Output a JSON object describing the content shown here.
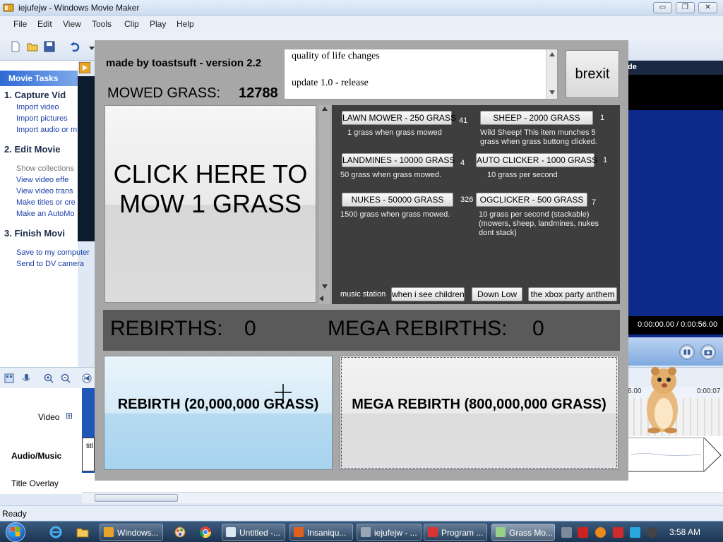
{
  "window": {
    "title": "iejufejw - Windows Movie Maker",
    "controls": {
      "minimize": "▭",
      "maximize": "❐",
      "close": "✕"
    }
  },
  "menu": [
    "File",
    "Edit",
    "View",
    "Tools",
    "Clip",
    "Play",
    "Help"
  ],
  "tasks": {
    "header": "Movie Tasks",
    "sections": [
      {
        "title": "1. Capture Vid",
        "links": [
          "Import video",
          "Import pictures",
          "Import audio or m"
        ]
      },
      {
        "title": "2. Edit Movie",
        "links": [
          "Show collections",
          "View video effe",
          "View video trans",
          "Make titles or cre",
          "Make an AutoMo"
        ]
      },
      {
        "title": "3. Finish Movi",
        "links": [
          "Save to my computer",
          "Send to DV camera"
        ]
      }
    ]
  },
  "monitor": {
    "header": "de",
    "time": "0:00:00.00 / 0:00:56.00"
  },
  "timeline": {
    "tracks": [
      "Video",
      "Audio/Music",
      "Title Overlay"
    ],
    "expand": "⊞",
    "ruler_marks": [
      "6.00",
      "0:00:07"
    ],
    "audio_clip_label": "titl"
  },
  "status": "Ready",
  "taskbar": {
    "buttons": [
      "Windows...",
      "Untitled -...",
      "Insaniqu...",
      "iejufejw - ...",
      "Program ...",
      "Grass Mo..."
    ],
    "active_index": 5,
    "clock": "3:58 AM"
  },
  "game": {
    "credit": "made by toastsuft - version 2.2",
    "notes": [
      "quality of life changes",
      "update 1.0 - release"
    ],
    "brexit_label": "brexit",
    "mowed_label": "MOWED GRASS:",
    "mowed_value": "12788",
    "mow_button": "CLICK HERE TO MOW 1 GRASS",
    "shop": [
      {
        "button": "LAWN MOWER - 250 GRASS",
        "count": "41",
        "desc": "1 grass when grass mowed"
      },
      {
        "button": "SHEEP - 2000 GRASS",
        "count": "1",
        "desc": "Wild Sheep! This item munches 5 grass when grass buttong clicked."
      },
      {
        "button": "LANDMINES - 10000 GRASS",
        "count": "4",
        "desc": "50 grass when grass mowed."
      },
      {
        "button": "AUTO CLICKER - 1000 GRASS",
        "count": "1",
        "desc": "10 grass per second"
      },
      {
        "button": "NUKES - 50000 GRASS",
        "count": "326",
        "desc": "1500 grass when grass mowed."
      },
      {
        "button": "OGCLICKER - 500 GRASS",
        "count": "7",
        "desc": "10 grass per second (stackable) (mowers, sheep, landmines, nukes dont stack)"
      }
    ],
    "music": {
      "label": "music station",
      "buttons": [
        "when i see children",
        "Down Low",
        "the xbox party anthem"
      ]
    },
    "rebirths_label": "REBIRTHS:",
    "rebirths_value": "0",
    "mega_rebirths_label": "MEGA REBIRTHS:",
    "mega_rebirths_value": "0",
    "rebirth_button": "REBIRTH (20,000,000 GRASS)",
    "mega_rebirth_button": "MEGA REBIRTH (800,000,000 GRASS)"
  }
}
